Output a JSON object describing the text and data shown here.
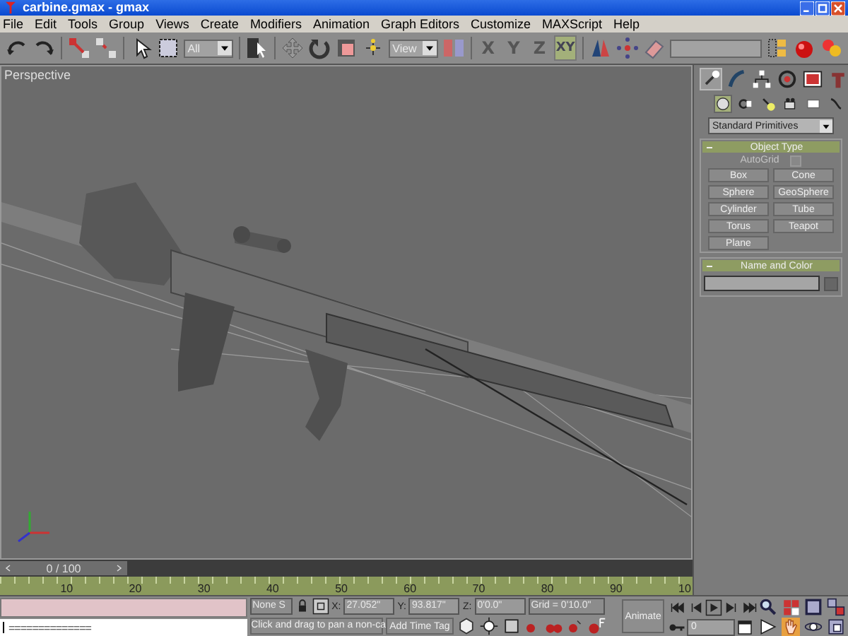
{
  "window": {
    "title": "carbine.gmax - gmax"
  },
  "menu": [
    "File",
    "Edit",
    "Tools",
    "Group",
    "Views",
    "Create",
    "Modifiers",
    "Animation",
    "Graph Editors",
    "Customize",
    "MAXScript",
    "Help"
  ],
  "toolbar": {
    "selection_filter": "All",
    "reference_coordinate": "View",
    "axis_buttons": [
      {
        "label": "X",
        "selected": false
      },
      {
        "label": "Y",
        "selected": false
      },
      {
        "label": "Z",
        "selected": false
      },
      {
        "label": "XY",
        "selected": true
      }
    ]
  },
  "viewport": {
    "label": "Perspective"
  },
  "command_panel": {
    "tabs": [
      {
        "selected": true
      },
      {
        "selected": false
      },
      {
        "selected": false
      },
      {
        "selected": false
      },
      {
        "selected": false
      },
      {
        "selected": false
      }
    ],
    "categories": [
      {
        "selected": true
      },
      {
        "selected": false
      },
      {
        "selected": false
      },
      {
        "selected": false
      },
      {
        "selected": false
      },
      {
        "selected": false
      }
    ],
    "dropdown": "Standard Primitives",
    "object_type": {
      "title": "Object Type",
      "autogrid": {
        "label": "AutoGrid",
        "checked": false,
        "disabled": true
      },
      "buttons": [
        "Box",
        "Cone",
        "Sphere",
        "GeoSphere",
        "Cylinder",
        "Tube",
        "Torus",
        "Teapot",
        "Plane"
      ]
    },
    "name_and_color": {
      "title": "Name and Color"
    }
  },
  "time_slider": {
    "label": "0 / 100",
    "level": 0
  },
  "track_bar": {
    "labels": [
      "10",
      "20",
      "30",
      "40",
      "50",
      "60",
      "70",
      "80",
      "90",
      "10"
    ]
  },
  "status": {
    "listener": "==============",
    "selection": "None S",
    "coordinates": [
      {
        "label": "X:",
        "value": "27.052\""
      },
      {
        "label": "Y:",
        "value": "93.817\""
      },
      {
        "label": "Z:",
        "value": "0'0.0\""
      }
    ],
    "grid": "Grid = 0'10.0\"",
    "prompt": "Click and drag to pan a non-ca",
    "add_time_tag": "Add Time Tag",
    "animate": "Animate",
    "frame": "0"
  }
}
